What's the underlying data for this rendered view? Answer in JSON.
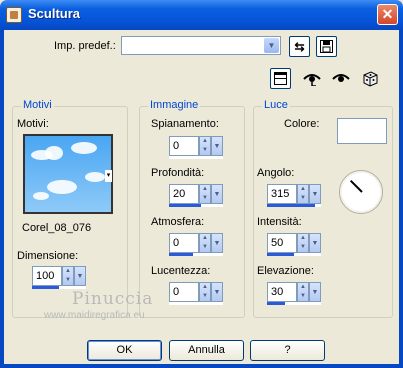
{
  "window": {
    "title": "Scultura",
    "close_glyph": "✕"
  },
  "preset": {
    "label": "Imp. predef.:",
    "value": ""
  },
  "toolbar": {
    "icons": [
      "reset-icon",
      "save-icon",
      "preview-toggle-icon",
      "eye-icon",
      "eye-alt-icon",
      "random-dice-icon"
    ]
  },
  "motivi": {
    "group_title": "Motivi",
    "label": "Motivi:",
    "pattern_name": "Corel_08_076",
    "dimensione_label": "Dimensione:",
    "dimensione_value": "100",
    "dimensione_level": 0.5
  },
  "immagine": {
    "group_title": "Immagine",
    "spianamento_label": "Spianamento:",
    "spianamento_value": "0",
    "spianamento_level": 0.0,
    "profondita_label": "Profondità:",
    "profondita_value": "20",
    "profondita_level": 0.6,
    "atmosfera_label": "Atmosfera:",
    "atmosfera_value": "0",
    "atmosfera_level": 0.45,
    "lucentezza_label": "Lucentezza:",
    "lucentezza_value": "0",
    "lucentezza_level": 0.0
  },
  "luce": {
    "group_title": "Luce",
    "colore_label": "Colore:",
    "colore_value": "#ffffff",
    "angolo_label": "Angolo:",
    "angolo_value": "315",
    "angolo_level": 0.88,
    "intensita_label": "Intensità:",
    "intensita_value": "50",
    "intensita_level": 0.5,
    "elevazione_label": "Elevazione:",
    "elevazione_value": "30",
    "elevazione_level": 0.33
  },
  "buttons": {
    "ok": "OK",
    "annulla": "Annulla",
    "help": "?"
  },
  "watermark": {
    "name": "Pinuccia",
    "url": "www.maidiregrafica.eu"
  }
}
